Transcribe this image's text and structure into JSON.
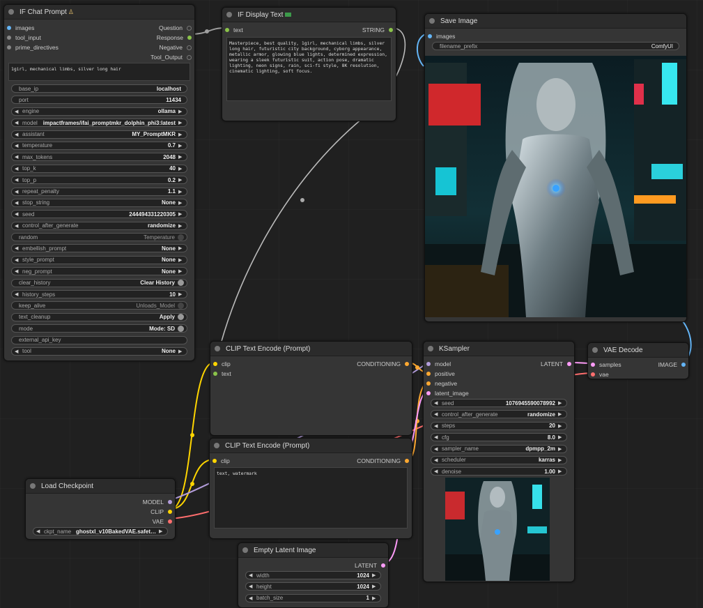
{
  "colors": {
    "canvas": "#202020",
    "node_bg": "#353535",
    "title_bg": "#2b2b2b",
    "image": "#64b5f6",
    "string": "#8bc34a",
    "conditioning": "#ffa931",
    "latent": "#ff9cf9",
    "model": "#b39ddb",
    "clip": "#ffd500",
    "vae": "#ff6e6e"
  },
  "if_chat_prompt": {
    "title": "IF Chat Prompt",
    "title_icon": "person-emoji-icon",
    "inputs": [
      "images",
      "tool_input",
      "prime_directives"
    ],
    "outputs": [
      "Question",
      "Response",
      "Negative",
      "Tool_Output"
    ],
    "prompt_text": "1girl, mechanical limbs, silver long hair",
    "widgets": [
      {
        "label": "base_ip",
        "value": "localhost",
        "kind": "plain"
      },
      {
        "label": "port",
        "value": "11434",
        "kind": "plain"
      },
      {
        "label": "engine",
        "value": "ollama",
        "kind": "combo"
      },
      {
        "label": "model",
        "value": "impactframes/ifai_promptmkr_dolphin_phi3:latest",
        "kind": "combo"
      },
      {
        "label": "assistant",
        "value": "MY_PromptMKR",
        "kind": "combo"
      },
      {
        "label": "temperature",
        "value": "0.7",
        "kind": "combo"
      },
      {
        "label": "max_tokens",
        "value": "2048",
        "kind": "combo"
      },
      {
        "label": "top_k",
        "value": "40",
        "kind": "combo"
      },
      {
        "label": "top_p",
        "value": "0.2",
        "kind": "combo"
      },
      {
        "label": "repeat_penalty",
        "value": "1.1",
        "kind": "combo"
      },
      {
        "label": "stop_string",
        "value": "None",
        "kind": "combo"
      },
      {
        "label": "seed",
        "value": "244494331220305",
        "kind": "combo"
      },
      {
        "label": "control_after_generate",
        "value": "randomize",
        "kind": "combo"
      },
      {
        "label": "random",
        "value": "Temperature",
        "kind": "toggle-off"
      },
      {
        "label": "embellish_prompt",
        "value": "None",
        "kind": "combo"
      },
      {
        "label": "style_prompt",
        "value": "None",
        "kind": "combo"
      },
      {
        "label": "neg_prompt",
        "value": "None",
        "kind": "combo"
      },
      {
        "label": "clear_history",
        "value": "Clear History",
        "kind": "toggle-on"
      },
      {
        "label": "history_steps",
        "value": "10",
        "kind": "combo"
      },
      {
        "label": "keep_alive",
        "value": "Unloads_Model",
        "kind": "toggle-off"
      },
      {
        "label": "text_cleanup",
        "value": "Apply",
        "kind": "toggle-on"
      },
      {
        "label": "mode",
        "value": "Mode: SD",
        "kind": "toggle-on"
      },
      {
        "label": "external_api_key",
        "value": "",
        "kind": "plain"
      },
      {
        "label": "tool",
        "value": "None",
        "kind": "combo"
      }
    ]
  },
  "if_display_text": {
    "title": "IF Display Text",
    "title_icon": "green-box-emoji-icon",
    "input": "text",
    "output": "STRING",
    "content": "Masterpiece, best quality, 1girl, mechanical limbs, silver long hair, futuristic city background, cyborg appearance, metallic armor, glowing blue lights, determined expression, wearing a sleek futuristic suit, action pose, dramatic lighting, neon signs, rain, sci-fi style, 8K resolution, cinematic lighting, soft focus."
  },
  "save_image": {
    "title": "Save Image",
    "input": "images",
    "filename_prefix_label": "filename_prefix",
    "filename_prefix_value": "ComfyUI"
  },
  "clip_encode_pos": {
    "title": "CLIP Text Encode (Prompt)",
    "inputs": [
      "clip",
      "text"
    ],
    "output": "CONDITIONING"
  },
  "clip_encode_neg": {
    "title": "CLIP Text Encode (Prompt)",
    "input": "clip",
    "output": "CONDITIONING",
    "text": "text, watermark"
  },
  "ksampler": {
    "title": "KSampler",
    "inputs": [
      "model",
      "positive",
      "negative",
      "latent_image"
    ],
    "output": "LATENT",
    "widgets": [
      {
        "label": "seed",
        "value": "1076945590078992"
      },
      {
        "label": "control_after_generate",
        "value": "randomize"
      },
      {
        "label": "steps",
        "value": "20"
      },
      {
        "label": "cfg",
        "value": "8.0"
      },
      {
        "label": "sampler_name",
        "value": "dpmpp_2m"
      },
      {
        "label": "scheduler",
        "value": "karras"
      },
      {
        "label": "denoise",
        "value": "1.00"
      }
    ]
  },
  "vae_decode": {
    "title": "VAE Decode",
    "inputs": [
      "samples",
      "vae"
    ],
    "output": "IMAGE"
  },
  "load_checkpoint": {
    "title": "Load Checkpoint",
    "outputs": [
      "MODEL",
      "CLIP",
      "VAE"
    ],
    "ckpt_label": "ckpt_name",
    "ckpt_value": "ghostxl_v10BakedVAE.safet…"
  },
  "empty_latent": {
    "title": "Empty Latent Image",
    "output": "LATENT",
    "widgets": [
      {
        "label": "width",
        "value": "1024"
      },
      {
        "label": "height",
        "value": "1024"
      },
      {
        "label": "batch_size",
        "value": "1"
      }
    ]
  }
}
